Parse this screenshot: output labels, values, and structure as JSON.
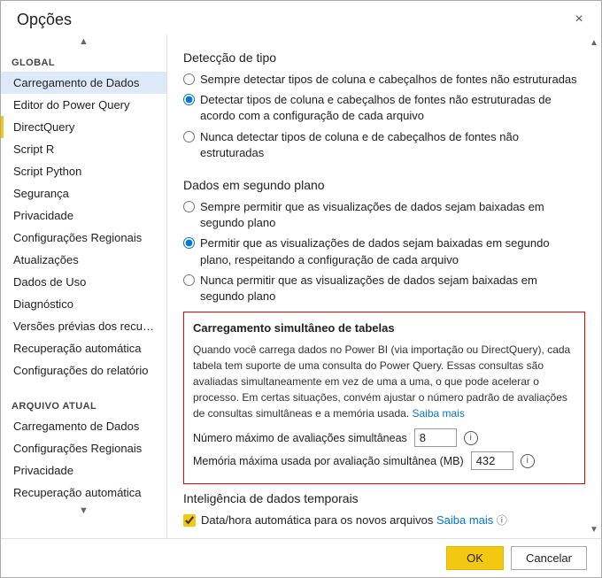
{
  "dialog": {
    "title": "Opções",
    "close_label": "×"
  },
  "sidebar": {
    "global_label": "GLOBAL",
    "arquivo_label": "ARQUIVO ATUAL",
    "global_items": [
      {
        "id": "carregamento-dados",
        "label": "Carregamento de Dados",
        "active": true,
        "selected": true
      },
      {
        "id": "editor-power-query",
        "label": "Editor do Power Query",
        "active": false
      },
      {
        "id": "directquery",
        "label": "DirectQuery",
        "active": true,
        "bold": true
      },
      {
        "id": "script-r",
        "label": "Script R",
        "active": false
      },
      {
        "id": "script-python",
        "label": "Script Python",
        "active": false
      },
      {
        "id": "seguranca",
        "label": "Segurança",
        "active": false
      },
      {
        "id": "privacidade",
        "label": "Privacidade",
        "active": false
      },
      {
        "id": "config-regionais",
        "label": "Configurações Regionais",
        "active": false
      },
      {
        "id": "atualizacoes",
        "label": "Atualizações",
        "active": false
      },
      {
        "id": "dados-de-uso",
        "label": "Dados de Uso",
        "active": false
      },
      {
        "id": "diagnostico",
        "label": "Diagnóstico",
        "active": false
      },
      {
        "id": "versoes-previas",
        "label": "Versões prévias dos recursos",
        "active": false
      },
      {
        "id": "recuperacao-auto",
        "label": "Recuperação automática",
        "active": false
      },
      {
        "id": "config-relatorio",
        "label": "Configurações do relatório",
        "active": false
      }
    ],
    "arquivo_items": [
      {
        "id": "a-carregamento",
        "label": "Carregamento de Dados",
        "active": false
      },
      {
        "id": "a-config-regionais",
        "label": "Configurações Regionais",
        "active": false
      },
      {
        "id": "a-privacidade",
        "label": "Privacidade",
        "active": false
      },
      {
        "id": "a-recuperacao",
        "label": "Recuperação automática",
        "active": false
      }
    ]
  },
  "main": {
    "type_detection": {
      "title": "Detecção de tipo",
      "options": [
        {
          "id": "td1",
          "label": "Sempre detectar tipos de coluna e cabeçalhos de fontes não estruturadas",
          "selected": false
        },
        {
          "id": "td2",
          "label": "Detectar tipos de coluna e cabeçalhos de fontes não estruturadas de acordo com a configuração de cada arquivo",
          "selected": true
        },
        {
          "id": "td3",
          "label": "Nunca detectar tipos de coluna e de cabeçalhos de fontes não estruturadas",
          "selected": false
        }
      ]
    },
    "background_data": {
      "title": "Dados em segundo plano",
      "options": [
        {
          "id": "bd1",
          "label": "Sempre permitir que as visualizações de dados sejam baixadas em segundo plano",
          "selected": false
        },
        {
          "id": "bd2",
          "label": "Permitir que as visualizações de dados sejam baixadas em segundo plano, respeitando a configuração de cada arquivo",
          "selected": true
        },
        {
          "id": "bd3",
          "label": "Nunca permitir que as visualizações de dados sejam baixadas em segundo plano",
          "selected": false
        }
      ]
    },
    "simult_loading": {
      "title": "Carregamento simultâneo de tabelas",
      "description": "Quando você carrega dados no Power BI (via importação ou DirectQuery), cada tabela tem suporte de uma consulta do Power Query. Essas consultas são avaliadas simultaneamente em vez de uma a uma, o que pode acelerar o processo. Em certas situações, convém ajustar o número padrão de avaliações de consultas simultâneas e a memória usada.",
      "link_label": "Saiba mais",
      "max_evals_label": "Número máximo de avaliações simultâneas",
      "max_evals_value": "8",
      "max_memory_label": "Memória máxima usada por avaliação simultânea (MB)",
      "max_memory_value": "432"
    },
    "temporal": {
      "title": "Inteligência de dados temporais",
      "checkbox_label": "Data/hora automática para os novos arquivos",
      "checkbox_link": "Saiba mais",
      "checkbox_checked": true
    }
  },
  "footer": {
    "ok_label": "OK",
    "cancel_label": "Cancelar"
  },
  "icons": {
    "close": "×",
    "chevron_up": "▲",
    "chevron_down": "▼",
    "info": "i",
    "check": "✓"
  }
}
